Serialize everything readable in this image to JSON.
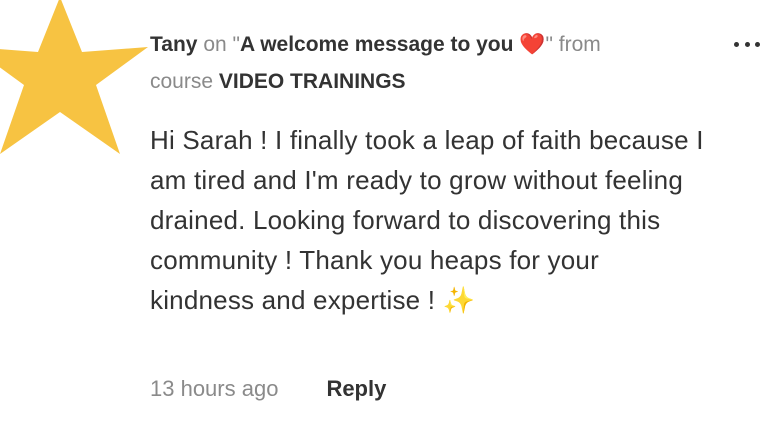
{
  "comment": {
    "author": "Tany",
    "on_word": "on",
    "quote_open": "\"",
    "post_title": "A welcome message to you",
    "heart_emoji": "❤️",
    "quote_close": "\"",
    "from_word": "from",
    "course_word": "course",
    "course_name": "VIDEO TRAININGS",
    "body": "Hi Sarah ! I finally took a leap of faith because I am tired and I'm ready to grow without feeling drained. Looking forward to discovering this community ! Thank you heaps for your kindness and expertise !",
    "body_emoji": "✨",
    "timestamp": "13 hours ago",
    "reply_label": "Reply"
  },
  "icons": {
    "avatar": "star-avatar-icon",
    "menu": "more-options-icon"
  },
  "colors": {
    "star": "#F7C342",
    "heart": "#E0212B",
    "text": "#333333",
    "muted": "#8A8A8A"
  }
}
